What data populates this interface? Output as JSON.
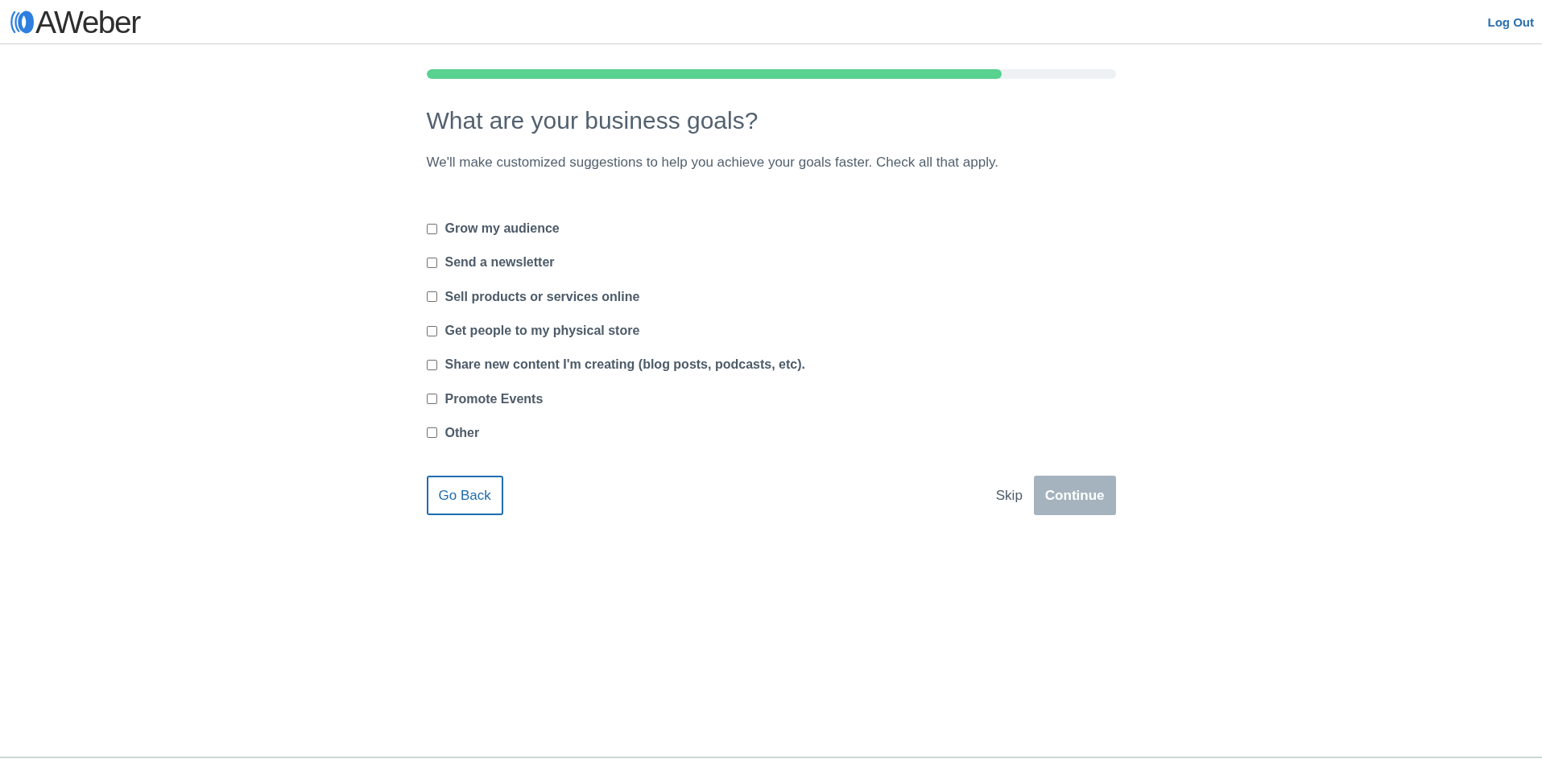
{
  "header": {
    "logo": "AWeber",
    "logout": "Log Out"
  },
  "progress": {
    "level": 0.835
  },
  "heading": "What are your business goals?",
  "description": "We'll make customized suggestions to help you achieve your goals faster. Check all that apply.",
  "goals": [
    {
      "label": "Grow my audience",
      "checked": false
    },
    {
      "label": "Send a newsletter",
      "checked": false
    },
    {
      "label": "Sell products or services online",
      "checked": false
    },
    {
      "label": "Get people to my physical store",
      "checked": false
    },
    {
      "label": "Share new content I'm creating (blog posts, podcasts, etc).",
      "checked": false
    },
    {
      "label": "Promote Events",
      "checked": false
    },
    {
      "label": "Other",
      "checked": false
    }
  ],
  "actions": {
    "back": "Go Back",
    "skip": "Skip",
    "continue": {
      "label": "Continue",
      "disabled": true
    }
  }
}
